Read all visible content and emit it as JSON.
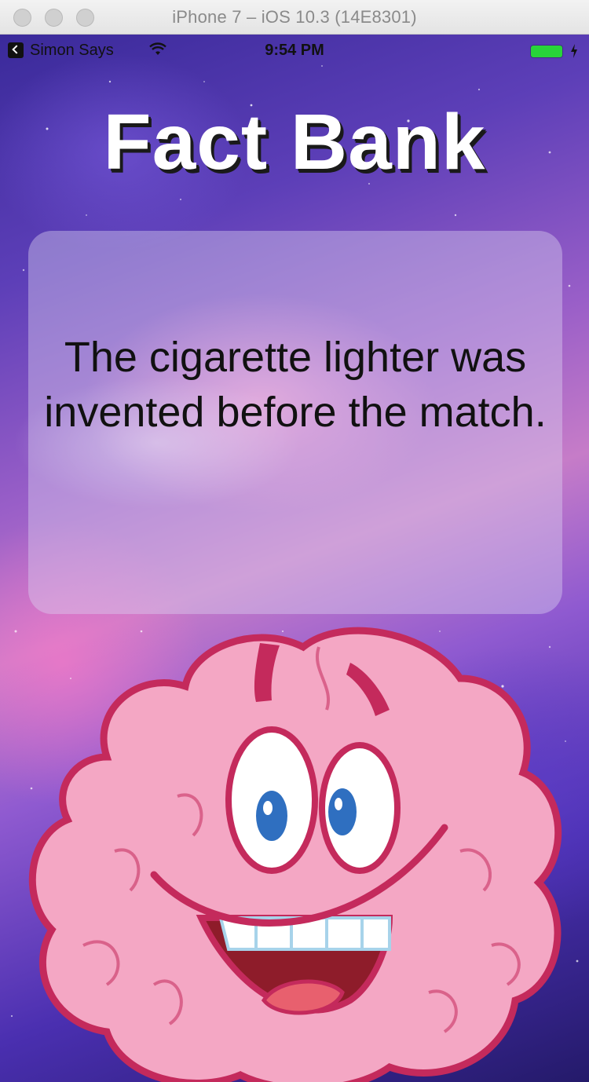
{
  "window": {
    "title": "iPhone 7 – iOS 10.3 (14E8301)"
  },
  "status_bar": {
    "carrier": "Simon Says",
    "time": "9:54 PM",
    "battery_color": "#28d43a"
  },
  "app": {
    "title": "Fact Bank",
    "fact": "The cigarette lighter was invented before the match."
  },
  "icons": [
    "back-icon",
    "wifi-icon",
    "battery-icon",
    "charge-icon",
    "brain-mascot"
  ]
}
